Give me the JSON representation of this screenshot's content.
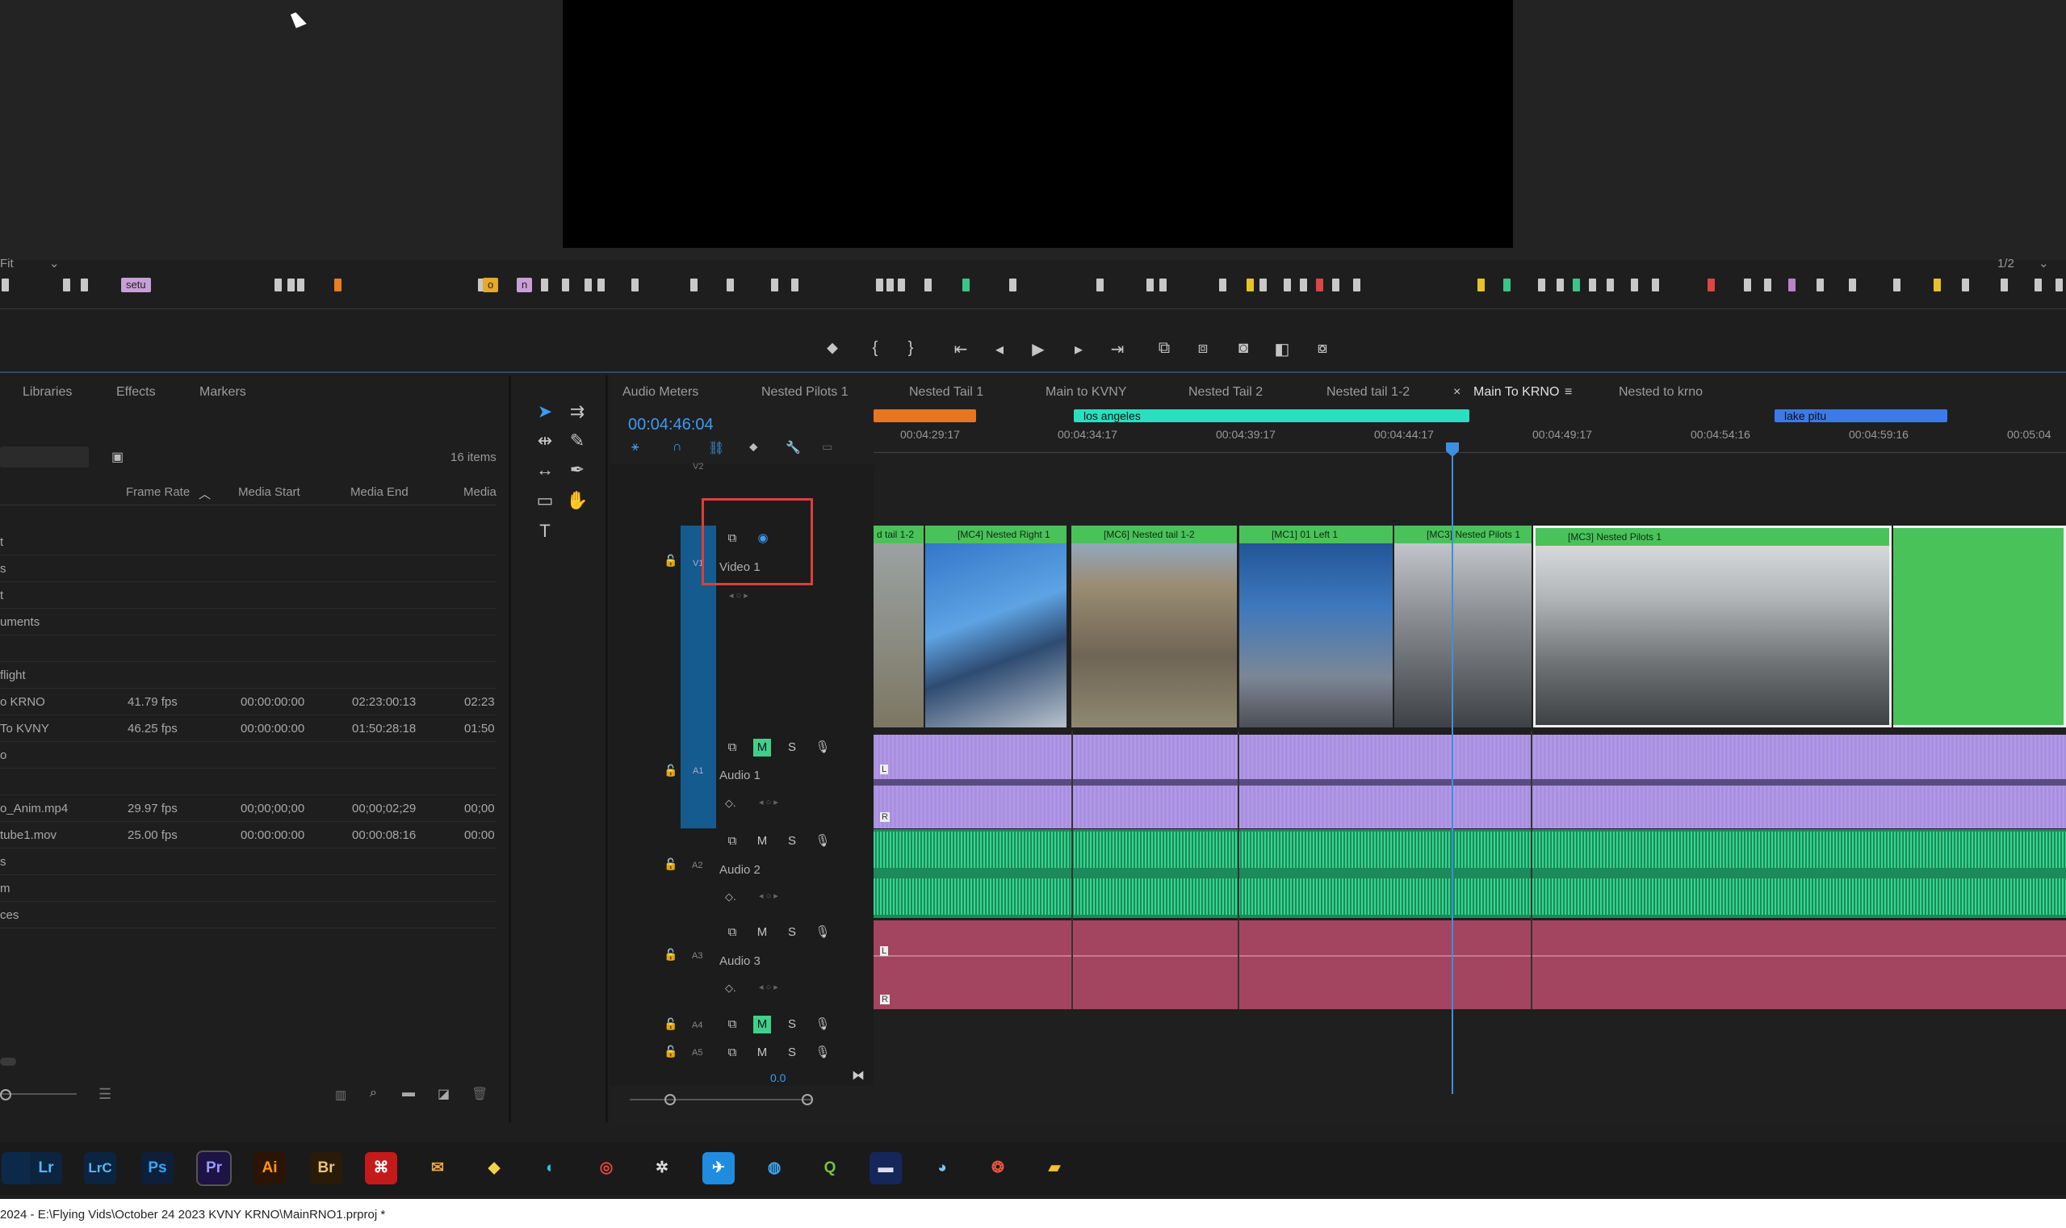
{
  "program_monitor": {
    "fit_label": "Fit",
    "resolution": "1/2"
  },
  "marker_tags": {
    "tag1": "setu",
    "tag2": "o",
    "tag3": "n"
  },
  "project_panel": {
    "tabs": [
      "Libraries",
      "Effects",
      "Markers"
    ],
    "items_count": "16 items",
    "columns": [
      "Frame Rate",
      "Media Start",
      "Media End",
      "Media"
    ],
    "rows": [
      {
        "name": "t",
        "fps": "",
        "start": "",
        "end": "",
        "media": ""
      },
      {
        "name": "s",
        "fps": "",
        "start": "",
        "end": "",
        "media": ""
      },
      {
        "name": "t",
        "fps": "",
        "start": "",
        "end": "",
        "media": ""
      },
      {
        "name": "uments",
        "fps": "",
        "start": "",
        "end": "",
        "media": ""
      },
      {
        "name": "",
        "fps": "",
        "start": "",
        "end": "",
        "media": ""
      },
      {
        "name": "flight",
        "fps": "",
        "start": "",
        "end": "",
        "media": ""
      },
      {
        "name": "o KRNO",
        "fps": "41.79 fps",
        "start": "00:00:00:00",
        "end": "02:23:00:13",
        "media": "02:23"
      },
      {
        "name": "To KVNY",
        "fps": "46.25 fps",
        "start": "00:00:00:00",
        "end": "01:50:28:18",
        "media": "01:50"
      },
      {
        "name": "o",
        "fps": "",
        "start": "",
        "end": "",
        "media": ""
      },
      {
        "name": "",
        "fps": "",
        "start": "",
        "end": "",
        "media": ""
      },
      {
        "name": "o_Anim.mp4",
        "fps": "29.97 fps",
        "start": "00;00;00;00",
        "end": "00;00;02;29",
        "media": "00;00"
      },
      {
        "name": "tube1.mov",
        "fps": "25.00 fps",
        "start": "00:00:00:00",
        "end": "00:00:08:16",
        "media": "00:00"
      },
      {
        "name": "s",
        "fps": "",
        "start": "",
        "end": "",
        "media": ""
      },
      {
        "name": "m",
        "fps": "",
        "start": "",
        "end": "",
        "media": ""
      },
      {
        "name": "ces",
        "fps": "",
        "start": "",
        "end": "",
        "media": ""
      }
    ]
  },
  "timeline": {
    "tabs": [
      "Audio Meters",
      "Nested Pilots 1",
      "Nested Tail 1",
      "Main to KVNY",
      "Nested Tail 2",
      "Nested tail 1-2",
      "Main To KRNO",
      "Nested to krno"
    ],
    "active_tab": "Main To KRNO",
    "timecode": "00:04:46:04",
    "ruler": [
      "00:04:29:17",
      "00:04:34:17",
      "00:04:39:17",
      "00:04:44:17",
      "00:04:49:17",
      "00:04:54:16",
      "00:04:59:16",
      "00:05:04"
    ],
    "range_labels": [
      "los angeles",
      "lake pitu"
    ],
    "tracks": {
      "v2": "V2",
      "v1": {
        "code": "V1",
        "name": "Video 1"
      },
      "a1": {
        "code": "A1",
        "name": "Audio 1"
      },
      "a2": {
        "code": "A2",
        "name": "Audio 2"
      },
      "a3": {
        "code": "A3",
        "name": "Audio 3"
      },
      "a4": {
        "code": "A4"
      },
      "a5": {
        "code": "A5"
      }
    },
    "mute_label": "M",
    "solo_label": "S",
    "master_level": "0.0",
    "clips": [
      "d tail 1-2",
      "[MC4] Nested Right 1",
      "[MC6] Nested tail 1-2",
      "[MC1] 01 Left 1",
      "[MC3] Nested Pilots 1",
      "[MC3] Nested Pilots 1"
    ],
    "clip_channel_labels": {
      "left": "L",
      "right": "R"
    }
  },
  "taskbar": {
    "apps": [
      "Lr",
      "LrC",
      "Ps",
      "Pr",
      "Ai",
      "Br"
    ]
  },
  "status": {
    "title": "2024 - E:\\Flying Vids\\October 24 2023 KVNY KRNO\\MainRNO1.prproj *"
  },
  "colors": {
    "accent": "#3d9bf0",
    "audio1": "#a98fe0",
    "audio2": "#2fb978",
    "audio3": "#a34560",
    "clip_label": "#4ac25a",
    "highlight": "#d9413a"
  }
}
